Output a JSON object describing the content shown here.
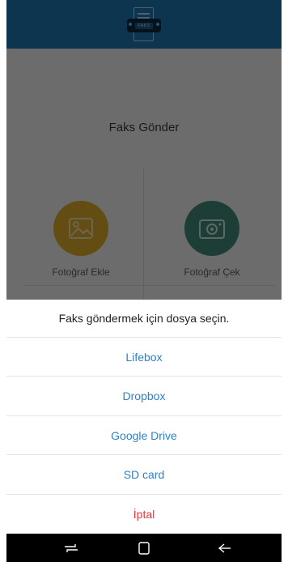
{
  "header": {
    "logo_text": "FAKS",
    "background_color": "#1d6aa0"
  },
  "main": {
    "title": "Faks Gönder",
    "actions": [
      {
        "label": "Fotoğraf Ekle",
        "icon": "image-icon",
        "color": "#c69b27"
      },
      {
        "label": "Fotoğraf Çek",
        "icon": "camera-icon",
        "color": "#3b7c6d"
      }
    ]
  },
  "sheet": {
    "title": "Faks göndermek için dosya seçin.",
    "options": [
      {
        "label": "Lifebox"
      },
      {
        "label": "Dropbox"
      },
      {
        "label": "Google Drive"
      },
      {
        "label": "SD card"
      }
    ],
    "cancel_label": "İptal",
    "option_color": "#2f81c5",
    "cancel_color": "#e23b3b"
  },
  "navbar": {
    "buttons": [
      "recent-apps-icon",
      "home-icon",
      "back-icon"
    ]
  }
}
